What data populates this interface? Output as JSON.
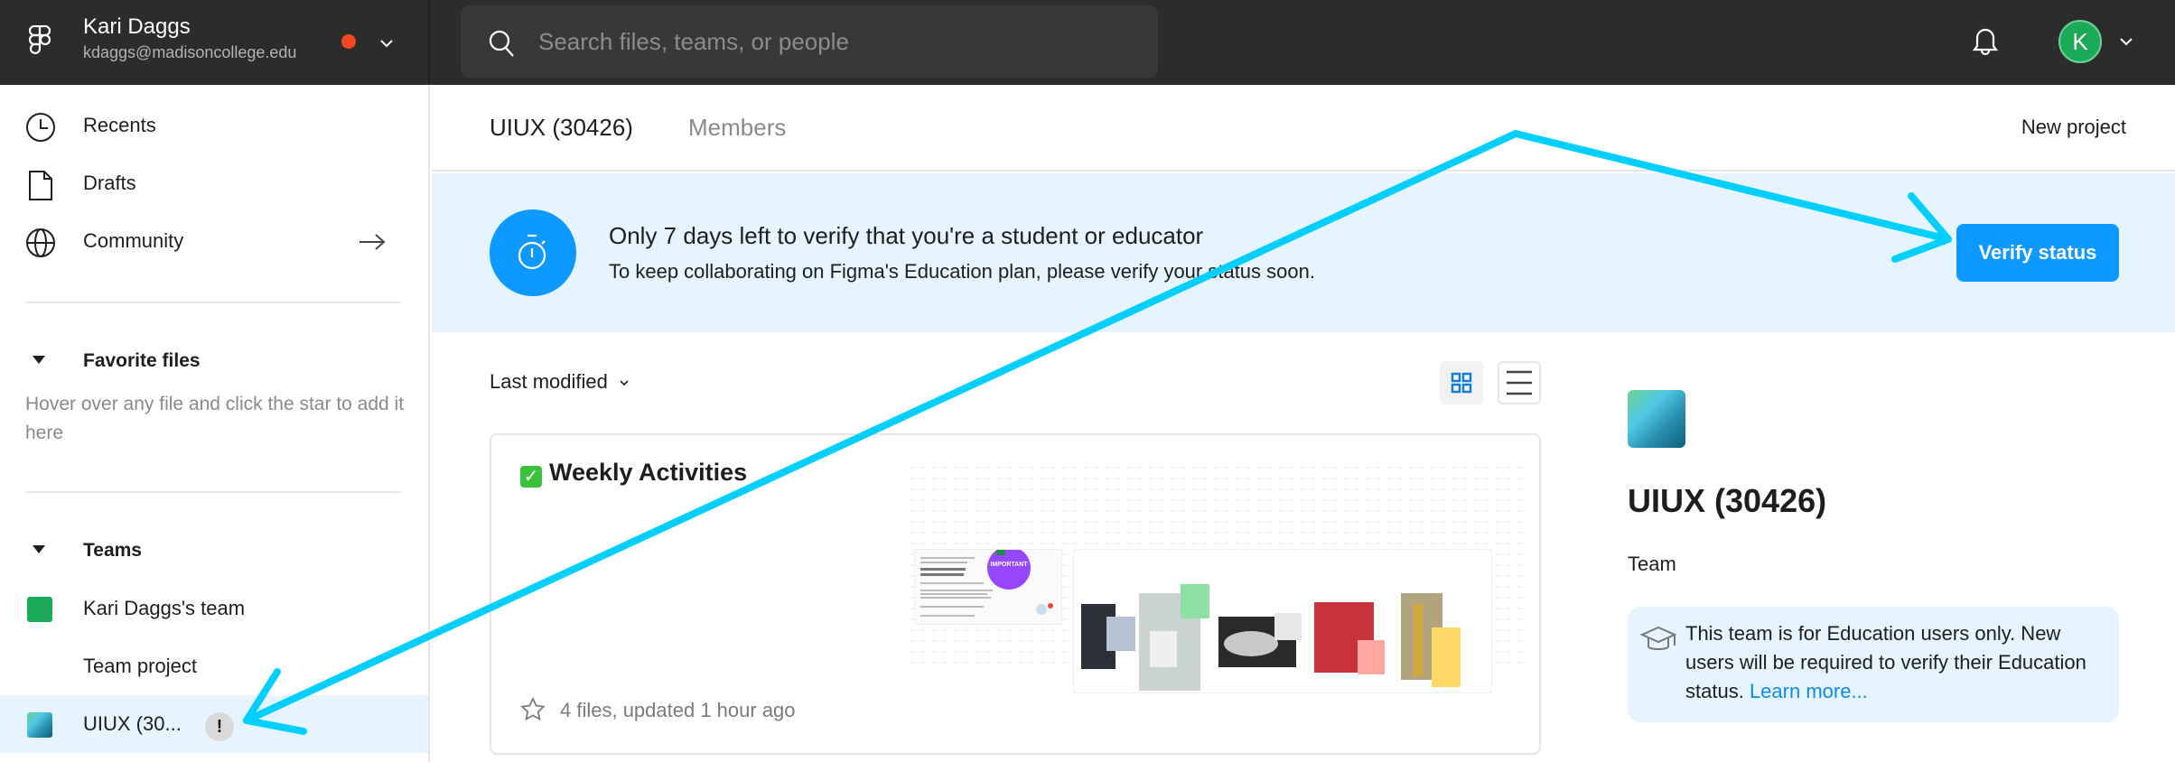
{
  "topbar": {
    "account_name": "Kari Daggs",
    "account_email": "kdaggs@madisoncollege.edu",
    "search_placeholder": "Search files, teams, or people",
    "search_value": "",
    "avatar_initial": "K",
    "notification_dot_color": "#f24822",
    "avatar_color": "#1bab58"
  },
  "sidebar": {
    "nav": [
      {
        "label": "Recents",
        "icon": "clock-icon"
      },
      {
        "label": "Drafts",
        "icon": "file-icon"
      },
      {
        "label": "Community",
        "icon": "globe-icon"
      }
    ],
    "favorites": {
      "heading": "Favorite files",
      "hint": "Hover over any file and click the star to add it here"
    },
    "teams": {
      "heading": "Teams",
      "items": [
        {
          "label": "Kari Daggs's team",
          "swatch": "#1bab58"
        },
        {
          "label": "Team project"
        },
        {
          "label": "UIUX (30...",
          "selected": true,
          "badge": "!"
        }
      ]
    }
  },
  "main": {
    "tabs": [
      {
        "label": "UIUX (30426)",
        "active": true
      },
      {
        "label": "Members",
        "active": false
      }
    ],
    "new_project_label": "New project",
    "banner": {
      "title": "Only 7 days left to verify that you're a student or educator",
      "subtitle": "To keep collaborating on Figma's Education plan, please verify your status soon.",
      "button_label": "Verify status",
      "accent": "#0d99ff"
    },
    "sort_label": "Last modified",
    "view_mode": "grid",
    "projects": [
      {
        "title": "Weekly Activities",
        "emoji": "✓",
        "meta": "4 files, updated 1 hour ago",
        "thumbnail_caption": "IMPORTANT"
      }
    ]
  },
  "team_panel": {
    "title": "UIUX (30426)",
    "kind": "Team",
    "notice_text": "This team is for Education users only. New users will be required to verify their Education status.",
    "notice_link": "Learn more..."
  },
  "annotation": {
    "color": "#00cfff",
    "arrows": 2
  }
}
